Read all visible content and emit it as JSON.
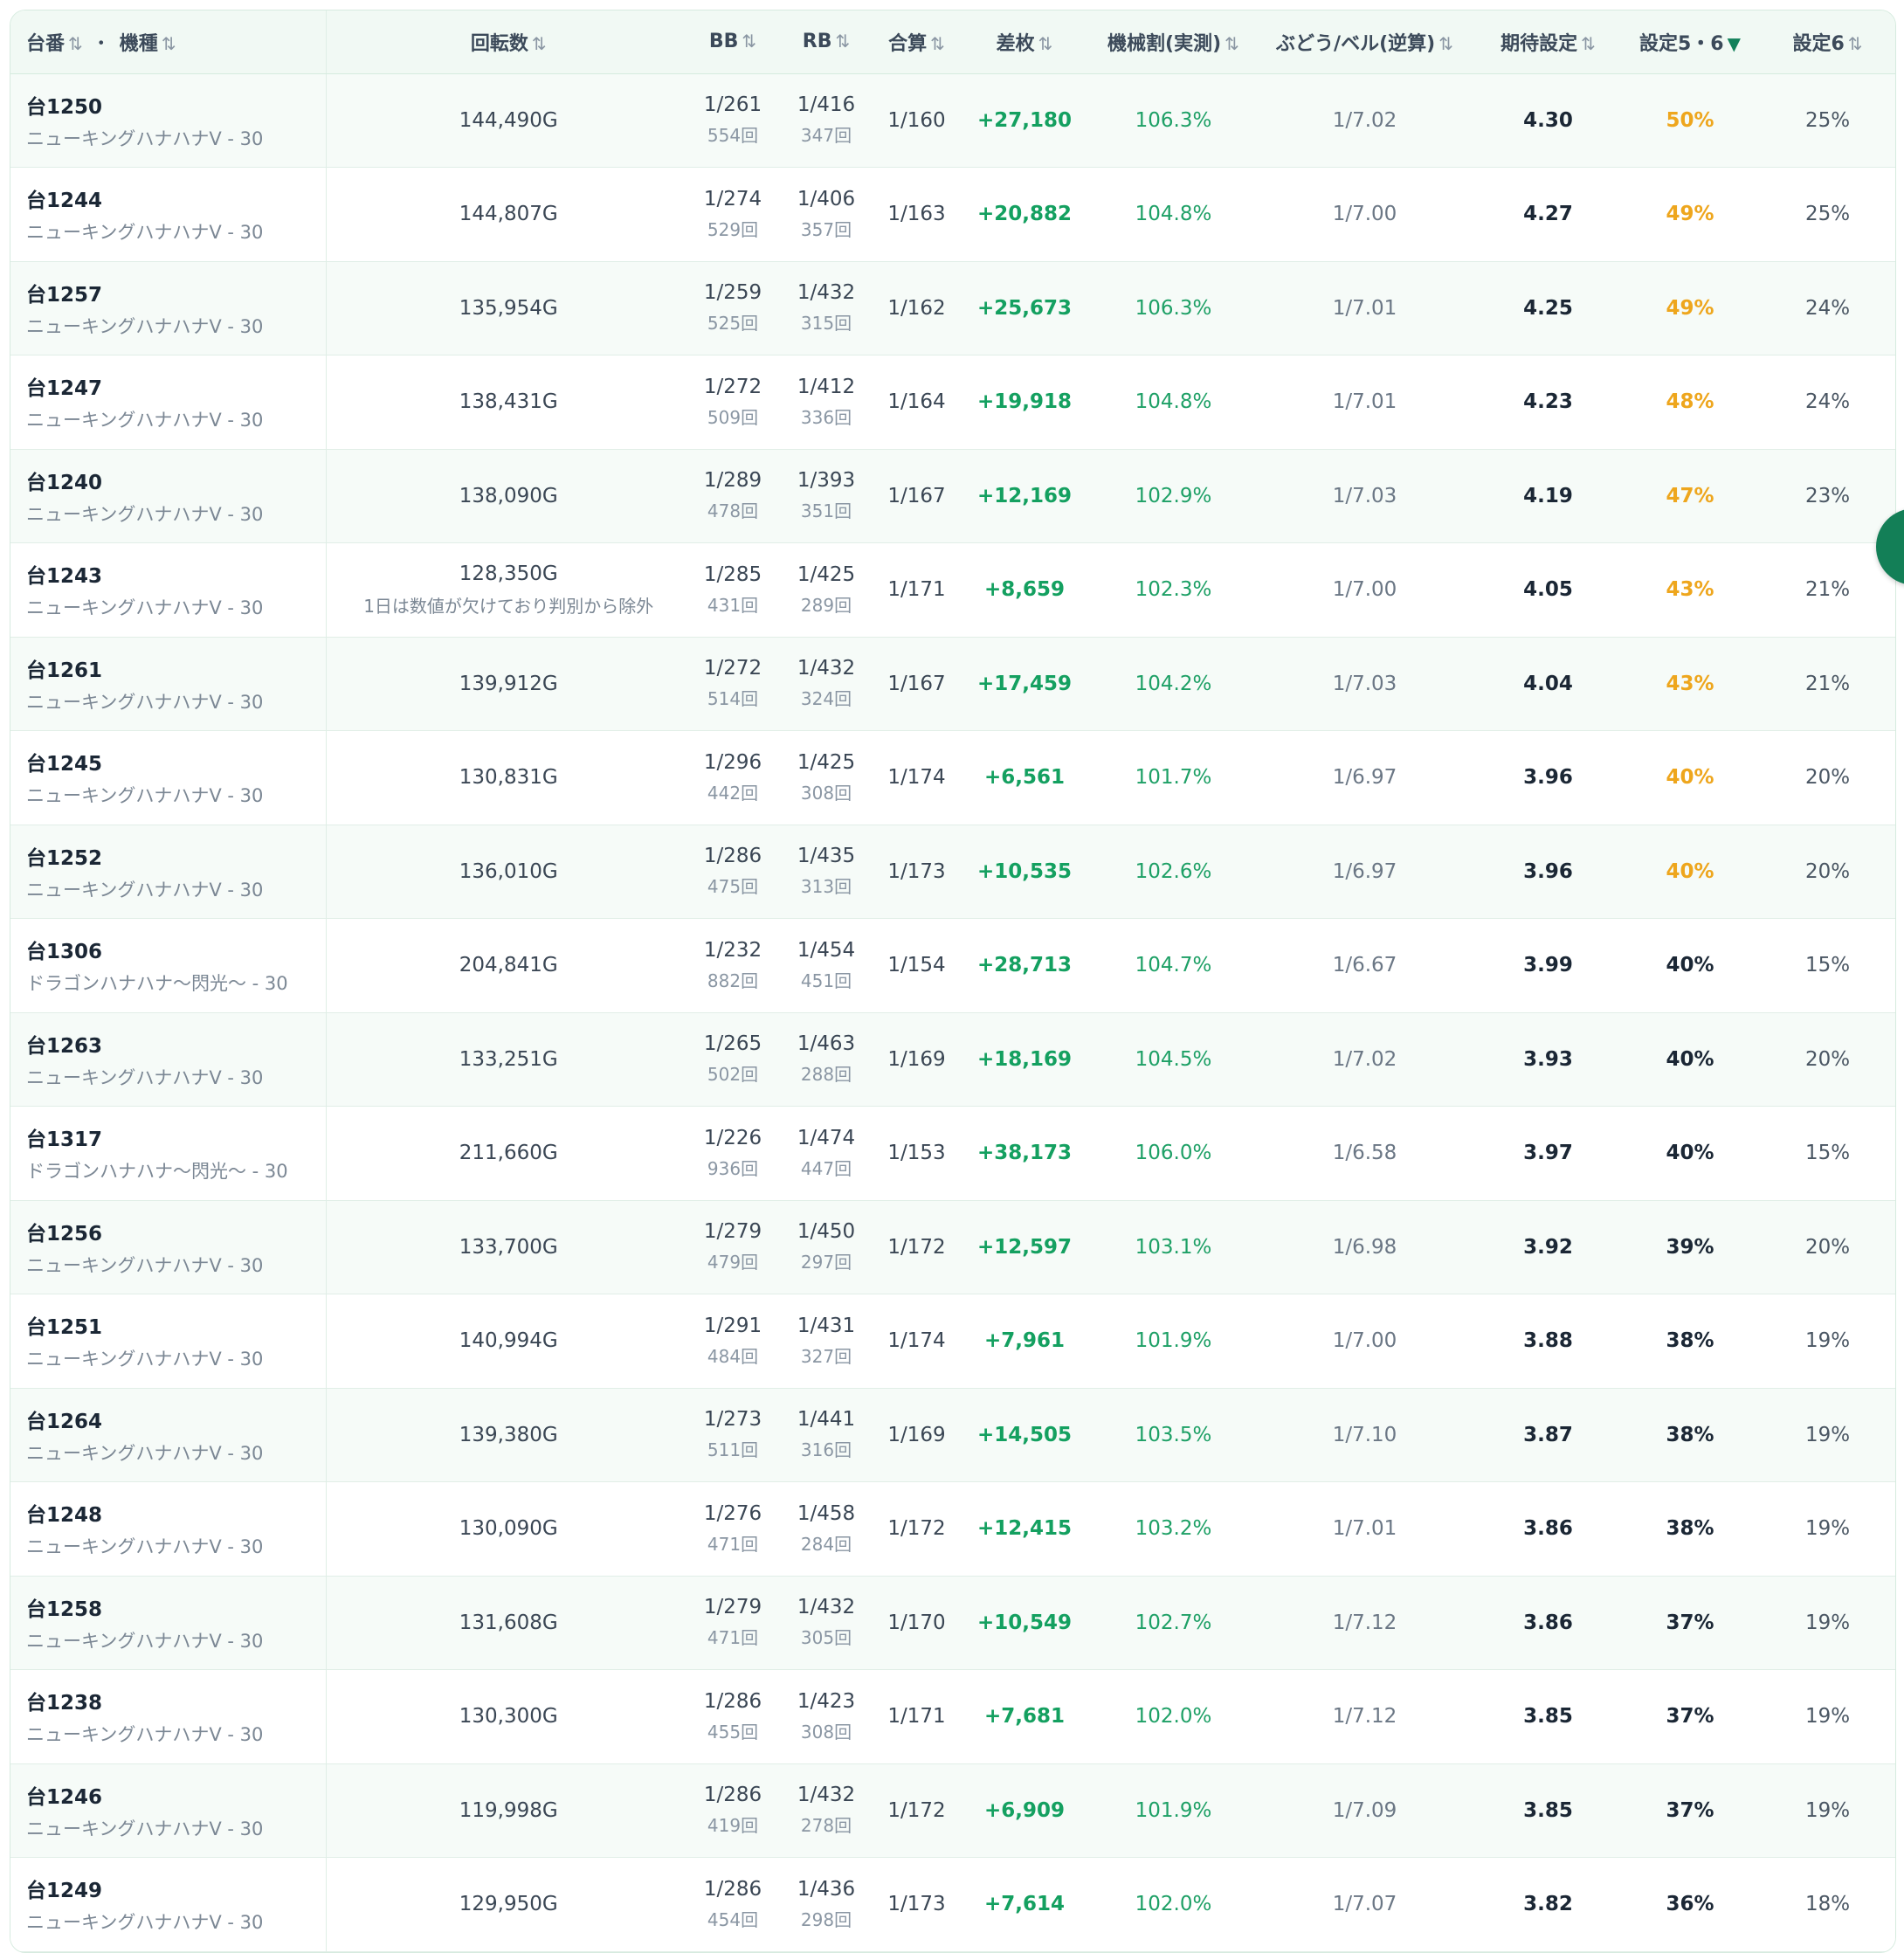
{
  "header": {
    "machine_no": "台番",
    "machine_type": "機種",
    "dot": "・",
    "spins": "回転数",
    "bb": "BB",
    "rb": "RB",
    "combined": "合算",
    "diff": "差枚",
    "payout_rate": "機械割(実測)",
    "grape": "ぶどう/ベル(逆算)",
    "expected_setting": "期待設定",
    "setting56": "設定5・6",
    "setting6": "設定6",
    "sort_icon": "⇅",
    "sort_active_icon": "▼"
  },
  "rows": [
    {
      "id": "台1250",
      "name": "ニューキングハナハナV - 30",
      "spins": "144,490G",
      "note": "",
      "bb": "1/261",
      "bb_count": "554回",
      "rb": "1/416",
      "rb_count": "347回",
      "combined": "1/160",
      "diff": "+27,180",
      "rate": "106.3%",
      "grape": "1/7.02",
      "exp": "4.30",
      "s56": "50%",
      "s56_hi": true,
      "s6": "25%"
    },
    {
      "id": "台1244",
      "name": "ニューキングハナハナV - 30",
      "spins": "144,807G",
      "note": "",
      "bb": "1/274",
      "bb_count": "529回",
      "rb": "1/406",
      "rb_count": "357回",
      "combined": "1/163",
      "diff": "+20,882",
      "rate": "104.8%",
      "grape": "1/7.00",
      "exp": "4.27",
      "s56": "49%",
      "s56_hi": true,
      "s6": "25%"
    },
    {
      "id": "台1257",
      "name": "ニューキングハナハナV - 30",
      "spins": "135,954G",
      "note": "",
      "bb": "1/259",
      "bb_count": "525回",
      "rb": "1/432",
      "rb_count": "315回",
      "combined": "1/162",
      "diff": "+25,673",
      "rate": "106.3%",
      "grape": "1/7.01",
      "exp": "4.25",
      "s56": "49%",
      "s56_hi": true,
      "s6": "24%"
    },
    {
      "id": "台1247",
      "name": "ニューキングハナハナV - 30",
      "spins": "138,431G",
      "note": "",
      "bb": "1/272",
      "bb_count": "509回",
      "rb": "1/412",
      "rb_count": "336回",
      "combined": "1/164",
      "diff": "+19,918",
      "rate": "104.8%",
      "grape": "1/7.01",
      "exp": "4.23",
      "s56": "48%",
      "s56_hi": true,
      "s6": "24%"
    },
    {
      "id": "台1240",
      "name": "ニューキングハナハナV - 30",
      "spins": "138,090G",
      "note": "",
      "bb": "1/289",
      "bb_count": "478回",
      "rb": "1/393",
      "rb_count": "351回",
      "combined": "1/167",
      "diff": "+12,169",
      "rate": "102.9%",
      "grape": "1/7.03",
      "exp": "4.19",
      "s56": "47%",
      "s56_hi": true,
      "s6": "23%"
    },
    {
      "id": "台1243",
      "name": "ニューキングハナハナV - 30",
      "spins": "128,350G",
      "note": "1日は数値が欠けており判別から除外",
      "bb": "1/285",
      "bb_count": "431回",
      "rb": "1/425",
      "rb_count": "289回",
      "combined": "1/171",
      "diff": "+8,659",
      "rate": "102.3%",
      "grape": "1/7.00",
      "exp": "4.05",
      "s56": "43%",
      "s56_hi": true,
      "s6": "21%"
    },
    {
      "id": "台1261",
      "name": "ニューキングハナハナV - 30",
      "spins": "139,912G",
      "note": "",
      "bb": "1/272",
      "bb_count": "514回",
      "rb": "1/432",
      "rb_count": "324回",
      "combined": "1/167",
      "diff": "+17,459",
      "rate": "104.2%",
      "grape": "1/7.03",
      "exp": "4.04",
      "s56": "43%",
      "s56_hi": true,
      "s6": "21%"
    },
    {
      "id": "台1245",
      "name": "ニューキングハナハナV - 30",
      "spins": "130,831G",
      "note": "",
      "bb": "1/296",
      "bb_count": "442回",
      "rb": "1/425",
      "rb_count": "308回",
      "combined": "1/174",
      "diff": "+6,561",
      "rate": "101.7%",
      "grape": "1/6.97",
      "exp": "3.96",
      "s56": "40%",
      "s56_hi": true,
      "s6": "20%"
    },
    {
      "id": "台1252",
      "name": "ニューキングハナハナV - 30",
      "spins": "136,010G",
      "note": "",
      "bb": "1/286",
      "bb_count": "475回",
      "rb": "1/435",
      "rb_count": "313回",
      "combined": "1/173",
      "diff": "+10,535",
      "rate": "102.6%",
      "grape": "1/6.97",
      "exp": "3.96",
      "s56": "40%",
      "s56_hi": true,
      "s6": "20%"
    },
    {
      "id": "台1306",
      "name": "ドラゴンハナハナ〜閃光〜 - 30",
      "spins": "204,841G",
      "note": "",
      "bb": "1/232",
      "bb_count": "882回",
      "rb": "1/454",
      "rb_count": "451回",
      "combined": "1/154",
      "diff": "+28,713",
      "rate": "104.7%",
      "grape": "1/6.67",
      "exp": "3.99",
      "s56": "40%",
      "s56_hi": false,
      "s6": "15%"
    },
    {
      "id": "台1263",
      "name": "ニューキングハナハナV - 30",
      "spins": "133,251G",
      "note": "",
      "bb": "1/265",
      "bb_count": "502回",
      "rb": "1/463",
      "rb_count": "288回",
      "combined": "1/169",
      "diff": "+18,169",
      "rate": "104.5%",
      "grape": "1/7.02",
      "exp": "3.93",
      "s56": "40%",
      "s56_hi": false,
      "s6": "20%"
    },
    {
      "id": "台1317",
      "name": "ドラゴンハナハナ〜閃光〜 - 30",
      "spins": "211,660G",
      "note": "",
      "bb": "1/226",
      "bb_count": "936回",
      "rb": "1/474",
      "rb_count": "447回",
      "combined": "1/153",
      "diff": "+38,173",
      "rate": "106.0%",
      "grape": "1/6.58",
      "exp": "3.97",
      "s56": "40%",
      "s56_hi": false,
      "s6": "15%"
    },
    {
      "id": "台1256",
      "name": "ニューキングハナハナV - 30",
      "spins": "133,700G",
      "note": "",
      "bb": "1/279",
      "bb_count": "479回",
      "rb": "1/450",
      "rb_count": "297回",
      "combined": "1/172",
      "diff": "+12,597",
      "rate": "103.1%",
      "grape": "1/6.98",
      "exp": "3.92",
      "s56": "39%",
      "s56_hi": false,
      "s6": "20%"
    },
    {
      "id": "台1251",
      "name": "ニューキングハナハナV - 30",
      "spins": "140,994G",
      "note": "",
      "bb": "1/291",
      "bb_count": "484回",
      "rb": "1/431",
      "rb_count": "327回",
      "combined": "1/174",
      "diff": "+7,961",
      "rate": "101.9%",
      "grape": "1/7.00",
      "exp": "3.88",
      "s56": "38%",
      "s56_hi": false,
      "s6": "19%"
    },
    {
      "id": "台1264",
      "name": "ニューキングハナハナV - 30",
      "spins": "139,380G",
      "note": "",
      "bb": "1/273",
      "bb_count": "511回",
      "rb": "1/441",
      "rb_count": "316回",
      "combined": "1/169",
      "diff": "+14,505",
      "rate": "103.5%",
      "grape": "1/7.10",
      "exp": "3.87",
      "s56": "38%",
      "s56_hi": false,
      "s6": "19%"
    },
    {
      "id": "台1248",
      "name": "ニューキングハナハナV - 30",
      "spins": "130,090G",
      "note": "",
      "bb": "1/276",
      "bb_count": "471回",
      "rb": "1/458",
      "rb_count": "284回",
      "combined": "1/172",
      "diff": "+12,415",
      "rate": "103.2%",
      "grape": "1/7.01",
      "exp": "3.86",
      "s56": "38%",
      "s56_hi": false,
      "s6": "19%"
    },
    {
      "id": "台1258",
      "name": "ニューキングハナハナV - 30",
      "spins": "131,608G",
      "note": "",
      "bb": "1/279",
      "bb_count": "471回",
      "rb": "1/432",
      "rb_count": "305回",
      "combined": "1/170",
      "diff": "+10,549",
      "rate": "102.7%",
      "grape": "1/7.12",
      "exp": "3.86",
      "s56": "37%",
      "s56_hi": false,
      "s6": "19%"
    },
    {
      "id": "台1238",
      "name": "ニューキングハナハナV - 30",
      "spins": "130,300G",
      "note": "",
      "bb": "1/286",
      "bb_count": "455回",
      "rb": "1/423",
      "rb_count": "308回",
      "combined": "1/171",
      "diff": "+7,681",
      "rate": "102.0%",
      "grape": "1/7.12",
      "exp": "3.85",
      "s56": "37%",
      "s56_hi": false,
      "s6": "19%"
    },
    {
      "id": "台1246",
      "name": "ニューキングハナハナV - 30",
      "spins": "119,998G",
      "note": "",
      "bb": "1/286",
      "bb_count": "419回",
      "rb": "1/432",
      "rb_count": "278回",
      "combined": "1/172",
      "diff": "+6,909",
      "rate": "101.9%",
      "grape": "1/7.09",
      "exp": "3.85",
      "s56": "37%",
      "s56_hi": false,
      "s6": "19%"
    },
    {
      "id": "台1249",
      "name": "ニューキングハナハナV - 30",
      "spins": "129,950G",
      "note": "",
      "bb": "1/286",
      "bb_count": "454回",
      "rb": "1/436",
      "rb_count": "298回",
      "combined": "1/173",
      "diff": "+7,614",
      "rate": "102.0%",
      "grape": "1/7.07",
      "exp": "3.82",
      "s56": "36%",
      "s56_hi": false,
      "s6": "18%"
    }
  ],
  "colors": {
    "positive": "#14a060",
    "highlight": "#eea61d",
    "accent": "#137f57"
  }
}
